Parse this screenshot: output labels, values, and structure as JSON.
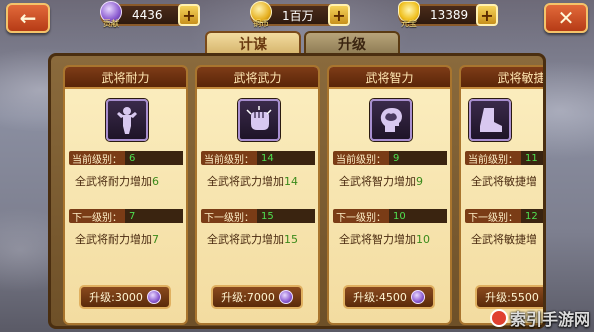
{
  "top_bar": {
    "contribution": {
      "icon_label": "贡献",
      "value": "4436"
    },
    "copper": {
      "icon_label": "铜币",
      "value": "1百万"
    },
    "yuanbao": {
      "icon_label": "元宝",
      "value": "13389"
    },
    "plus_label": "+",
    "back_icon": "←",
    "close_icon": "✕"
  },
  "tabs": [
    {
      "label": "计谋",
      "active": true
    },
    {
      "label": "升级",
      "active": false
    }
  ],
  "cards": [
    {
      "title": "武将耐力",
      "icon": "strength-figure-icon",
      "current_label": "当前级别：",
      "current_level": "6",
      "current_effect_text": "全武将耐力增加",
      "current_effect_num": "6",
      "next_label": "下一级别：",
      "next_level": "7",
      "next_effect_text": "全武将耐力增加",
      "next_effect_num": "7",
      "upgrade_label": "升级:3000"
    },
    {
      "title": "武将武力",
      "icon": "fist-icon",
      "current_label": "当前级别：",
      "current_level": "14",
      "current_effect_text": "全武将武力增加",
      "current_effect_num": "14",
      "next_label": "下一级别：",
      "next_level": "15",
      "next_effect_text": "全武将武力增加",
      "next_effect_num": "15",
      "upgrade_label": "升级:7000"
    },
    {
      "title": "武将智力",
      "icon": "brain-head-icon",
      "current_label": "当前级别：",
      "current_level": "9",
      "current_effect_text": "全武将智力增加",
      "current_effect_num": "9",
      "next_label": "下一级别：",
      "next_level": "10",
      "next_effect_text": "全武将智力增加",
      "next_effect_num": "10",
      "upgrade_label": "升级:4500"
    },
    {
      "title": "武将敏捷",
      "icon": "boot-icon",
      "current_label": "当前级别：",
      "current_level": "11",
      "current_effect_text": "全武将敏捷增",
      "current_effect_num": "",
      "next_label": "下一级别：",
      "next_level": "12",
      "next_effect_text": "全武将敏捷增",
      "next_effect_num": "",
      "upgrade_label": "升级:5500"
    }
  ],
  "watermark": "索引手游网"
}
